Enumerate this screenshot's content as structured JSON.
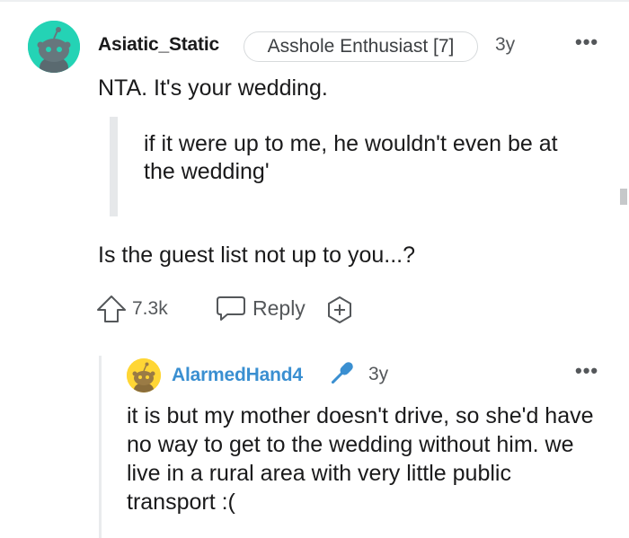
{
  "comment": {
    "avatar_icon": "snoo-avatar-icon",
    "avatar_color": "#24d3b5",
    "username": "Asiatic_Static",
    "flair": "Asshole Enthusiast [7]",
    "age": "3y",
    "more_icon": "more-dots-icon",
    "body_line": "NTA. It's your wedding.",
    "quote": "if it were up to me, he wouldn't even be at the wedding'",
    "question": "Is the guest list not up to you...?",
    "votes": "7.3k",
    "reply_label": "Reply",
    "upvote_icon": "upvote-arrow-icon",
    "reply_icon": "speech-bubble-icon",
    "award_icon": "add-award-icon"
  },
  "reply": {
    "avatar_icon": "snoo-avatar-icon",
    "avatar_color": "#ffd635",
    "username": "AlarmedHand4",
    "username_color": "#3a8fd1",
    "badge_icon": "microphone-icon",
    "age": "3y",
    "more_icon": "more-dots-icon",
    "body": "it is but my mother doesn't drive, so she'd have no way to get to the wedding without him. we live in a rural area with very little public transport :("
  }
}
